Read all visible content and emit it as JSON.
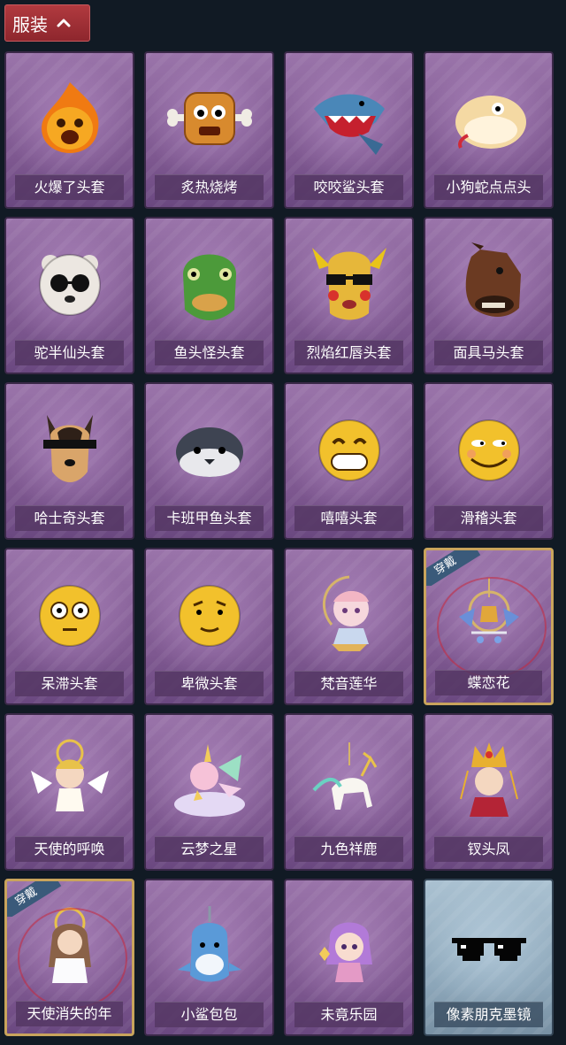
{
  "header": {
    "title": "服装",
    "icon": "chevron-up-icon"
  },
  "badge_label": "穿戴",
  "items": [
    {
      "name": "火爆了头套",
      "icon": "fire-mask-icon",
      "equipped": false,
      "special": false
    },
    {
      "name": "炙热烧烤",
      "icon": "bbq-meat-mask-icon",
      "equipped": false,
      "special": false
    },
    {
      "name": "咬咬鲨头套",
      "icon": "shark-mask-icon",
      "equipped": false,
      "special": false
    },
    {
      "name": "小狗蛇点点头",
      "icon": "snake-mask-icon",
      "equipped": false,
      "special": false
    },
    {
      "name": "驼半仙头套",
      "icon": "bear-sunglasses-mask-icon",
      "equipped": false,
      "special": false
    },
    {
      "name": "鱼头怪头套",
      "icon": "fish-head-mask-icon",
      "equipped": false,
      "special": false
    },
    {
      "name": "烈焰红唇头套",
      "icon": "pikachu-mask-icon",
      "equipped": false,
      "special": false
    },
    {
      "name": "面具马头套",
      "icon": "horse-mask-icon",
      "equipped": false,
      "special": false
    },
    {
      "name": "哈士奇头套",
      "icon": "husky-mask-icon",
      "equipped": false,
      "special": false
    },
    {
      "name": "卡班甲鱼头套",
      "icon": "puffer-fish-mask-icon",
      "equipped": false,
      "special": false
    },
    {
      "name": "嘻嘻头套",
      "icon": "grin-emoji-mask-icon",
      "equipped": false,
      "special": false
    },
    {
      "name": "滑稽头套",
      "icon": "smirk-emoji-mask-icon",
      "equipped": false,
      "special": false
    },
    {
      "name": "呆滞头套",
      "icon": "dazed-emoji-mask-icon",
      "equipped": false,
      "special": false
    },
    {
      "name": "卑微头套",
      "icon": "humble-emoji-mask-icon",
      "equipped": false,
      "special": false
    },
    {
      "name": "梵音莲华",
      "icon": "lotus-character-pendant-icon",
      "equipped": false,
      "special": false
    },
    {
      "name": "蝶恋花",
      "icon": "butterfly-bell-pendant-icon",
      "equipped": true,
      "special": false
    },
    {
      "name": "天使的呼唤",
      "icon": "angel-pendant-icon",
      "equipped": false,
      "special": false
    },
    {
      "name": "云梦之星",
      "icon": "unicorn-pendant-icon",
      "equipped": false,
      "special": false
    },
    {
      "name": "九色祥鹿",
      "icon": "deer-pendant-icon",
      "equipped": false,
      "special": false
    },
    {
      "name": "钗头凤",
      "icon": "phoenix-crown-pendant-icon",
      "equipped": false,
      "special": false
    },
    {
      "name": "天使消失的年",
      "icon": "angel-girl-pendant-icon",
      "equipped": true,
      "special": false
    },
    {
      "name": "小鲨包包",
      "icon": "shark-bag-pendant-icon",
      "equipped": false,
      "special": false
    },
    {
      "name": "未竟乐园",
      "icon": "paradise-girl-pendant-icon",
      "equipped": false,
      "special": false
    },
    {
      "name": "像素朋克墨镜",
      "icon": "pixel-sunglasses-icon",
      "equipped": false,
      "special": true
    }
  ],
  "colors": {
    "background": "#111a24",
    "header": "#a9343a",
    "card_purple": "#8a65a0",
    "card_blue": "#9ab3c6",
    "equipped_border": "#c9a45c",
    "badge": "#3a5a7a"
  }
}
